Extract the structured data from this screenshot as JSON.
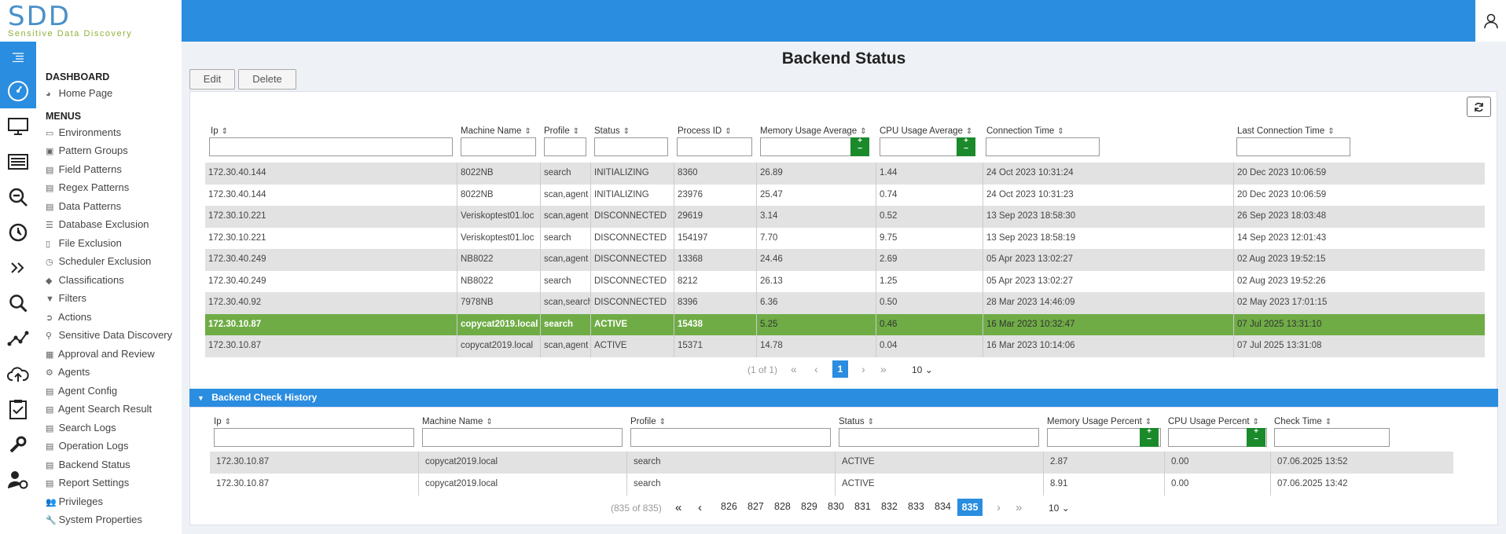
{
  "app": {
    "logo_main": "SDD",
    "logo_sub": "Sensitive Data Discovery"
  },
  "colors": {
    "accent": "#2a8de0",
    "active_row": "#6fac46",
    "plus_btn": "#1a8a2a"
  },
  "menu": {
    "dashboard_header": "DASHBOARD",
    "home": "Home Page",
    "menus_header": "MENUS",
    "items": [
      "Environments",
      "Pattern Groups",
      "Field Patterns",
      "Regex Patterns",
      "Data Patterns",
      "Database Exclusion",
      "File Exclusion",
      "Scheduler Exclusion",
      "Classifications",
      "Filters",
      "Actions",
      "Sensitive Data Discovery",
      "Approval and Review",
      "Agents",
      "Agent Config",
      "Agent Search Result",
      "Search Logs",
      "Operation Logs",
      "Backend Status",
      "Report Settings",
      "Privileges",
      "System Properties"
    ]
  },
  "page": {
    "title": "Backend Status",
    "edit": "Edit",
    "delete": "Delete"
  },
  "status_table": {
    "headers": [
      "Ip",
      "Machine Name",
      "Profile",
      "Status",
      "Process ID",
      "Memory Usage Average",
      "CPU Usage Average",
      "Connection Time",
      "Last Connection Time"
    ],
    "rows": [
      [
        "172.30.40.144",
        "8022NB",
        "search",
        "INITIALIZING",
        "8360",
        "26.89",
        "1.44",
        "24 Oct 2023 10:31:24",
        "20 Dec 2023 10:06:59"
      ],
      [
        "172.30.40.144",
        "8022NB",
        "scan,agent",
        "INITIALIZING",
        "23976",
        "25.47",
        "0.74",
        "24 Oct 2023 10:31:23",
        "20 Dec 2023 10:06:59"
      ],
      [
        "172.30.10.221",
        "Veriskoptest01.loc",
        "scan,agent",
        "DISCONNECTED",
        "29619",
        "3.14",
        "0.52",
        "13 Sep 2023 18:58:30",
        "26 Sep 2023 18:03:48"
      ],
      [
        "172.30.10.221",
        "Veriskoptest01.loc",
        "search",
        "DISCONNECTED",
        "154197",
        "7.70",
        "9.75",
        "13 Sep 2023 18:58:19",
        "14 Sep 2023 12:01:43"
      ],
      [
        "172.30.40.249",
        "NB8022",
        "scan,agent",
        "DISCONNECTED",
        "13368",
        "24.46",
        "2.69",
        "05 Apr 2023 13:02:27",
        "02 Aug 2023 19:52:15"
      ],
      [
        "172.30.40.249",
        "NB8022",
        "search",
        "DISCONNECTED",
        "8212",
        "26.13",
        "1.25",
        "05 Apr 2023 13:02:27",
        "02 Aug 2023 19:52:26"
      ],
      [
        "172.30.40.92",
        "7978NB",
        "scan,search",
        "DISCONNECTED",
        "8396",
        "6.36",
        "0.50",
        "28 Mar 2023 14:46:09",
        "02 May 2023 17:01:15"
      ],
      [
        "172.30.10.87",
        "copycat2019.local",
        "search",
        "ACTIVE",
        "15438",
        "5.25",
        "0.46",
        "16 Mar 2023 10:32:47",
        "07 Jul 2025 13:31:10"
      ],
      [
        "172.30.10.87",
        "copycat2019.local",
        "scan,agent",
        "ACTIVE",
        "15371",
        "14.78",
        "0.04",
        "16 Mar 2023 10:14:06",
        "07 Jul 2025 13:31:08"
      ]
    ],
    "pagination": {
      "info": "(1 of 1)",
      "current": "1",
      "per_page": "10"
    }
  },
  "history": {
    "title": "Backend Check History",
    "headers": [
      "Ip",
      "Machine Name",
      "Profile",
      "Status",
      "Memory Usage Percent",
      "CPU Usage Percent",
      "Check Time"
    ],
    "rows": [
      [
        "172.30.10.87",
        "copycat2019.local",
        "search",
        "ACTIVE",
        "2.87",
        "0.00",
        "07.06.2025 13:52"
      ],
      [
        "172.30.10.87",
        "copycat2019.local",
        "search",
        "ACTIVE",
        "8.91",
        "0.00",
        "07.06.2025 13:42"
      ]
    ],
    "pagination": {
      "info": "(835 of 835)",
      "pages": [
        "826",
        "827",
        "828",
        "829",
        "830",
        "831",
        "832",
        "833",
        "834",
        "835"
      ],
      "current": "835",
      "per_page": "10"
    }
  }
}
